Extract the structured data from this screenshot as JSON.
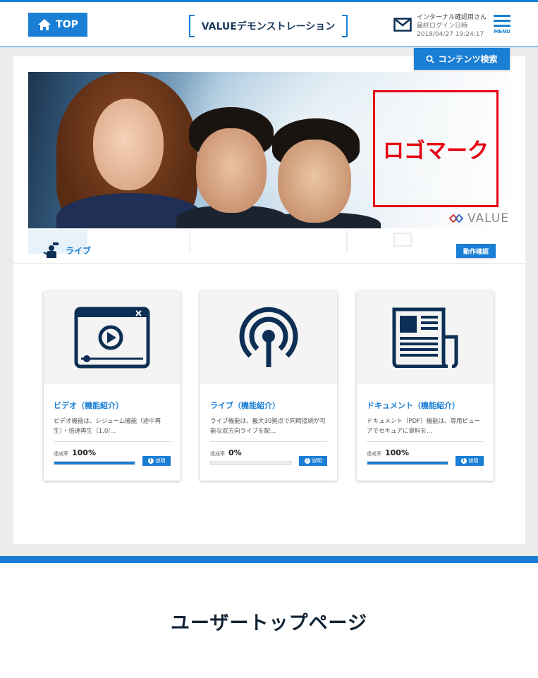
{
  "header": {
    "top_label": "TOP",
    "site_title": "VALUEデモンストレーション",
    "user_name": "インターナル確認用さん",
    "last_login_label": "最終ログイン日時",
    "last_login_time": "2018/04/27 19:24:17",
    "menu_label": "MENU"
  },
  "search_label": "コンテンツ検索",
  "hero": {
    "logo_placeholder": "ロゴマーク",
    "brand": "VALUE"
  },
  "section": {
    "title": "ライブ",
    "check_button": "動作確認"
  },
  "cards": [
    {
      "icon": "video-player-icon",
      "title": "ビデオ（機能紹介）",
      "desc": "ビデオ機能は、レジューム機能（途中再生）・倍速再生（1.0/...",
      "rate_label": "達成率",
      "rate": "100%",
      "progress": 1.0,
      "info_label": "説明"
    },
    {
      "icon": "broadcast-icon",
      "title": "ライブ（機能紹介）",
      "desc": "ライブ機能は、最大30拠点で同時接続が可能な双方向ライブを配...",
      "rate_label": "達成率",
      "rate": "0%",
      "progress": 0,
      "info_label": "説明"
    },
    {
      "icon": "document-icon",
      "title": "ドキュメント（機能紹介）",
      "desc": "ドキュメント（PDF）機能は、専用ビューアでセキュアに資料を...",
      "rate_label": "達成率",
      "rate": "100%",
      "progress": 1.0,
      "info_label": "説明"
    }
  ],
  "caption": "ユーザートップページ",
  "colors": {
    "accent": "#1a7fd4",
    "icon_navy": "#0d2f55",
    "logo_red": "#e60012"
  }
}
